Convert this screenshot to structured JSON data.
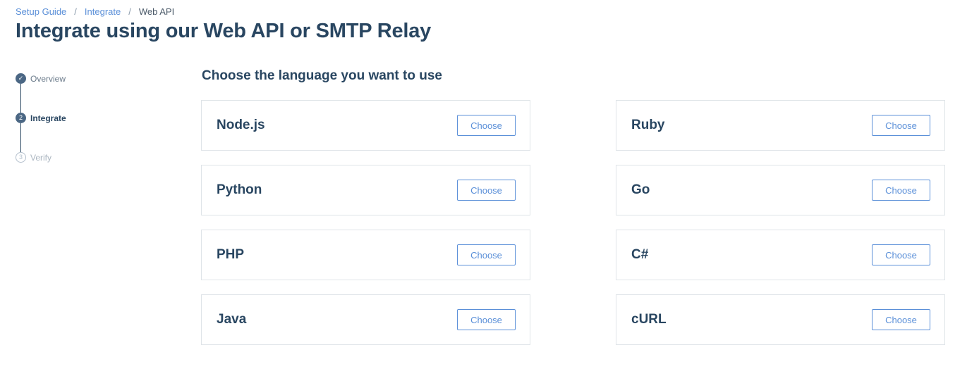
{
  "breadcrumb": {
    "items": [
      "Setup Guide",
      "Integrate",
      "Web API"
    ],
    "separator": "/"
  },
  "page_title": "Integrate using our Web API or SMTP Relay",
  "steps": [
    {
      "number": "✓",
      "label": "Overview",
      "state": "done"
    },
    {
      "number": "2",
      "label": "Integrate",
      "state": "active"
    },
    {
      "number": "3",
      "label": "Verify",
      "state": "todo"
    }
  ],
  "section_heading": "Choose the language you want to use",
  "languages": [
    {
      "name": "Node.js",
      "button": "Choose"
    },
    {
      "name": "Ruby",
      "button": "Choose"
    },
    {
      "name": "Python",
      "button": "Choose"
    },
    {
      "name": "Go",
      "button": "Choose"
    },
    {
      "name": "PHP",
      "button": "Choose"
    },
    {
      "name": "C#",
      "button": "Choose"
    },
    {
      "name": "Java",
      "button": "Choose"
    },
    {
      "name": "cURL",
      "button": "Choose"
    }
  ],
  "colors": {
    "heading": "#294661",
    "link": "#5a8fd8",
    "card_border": "#dfe4e8"
  }
}
